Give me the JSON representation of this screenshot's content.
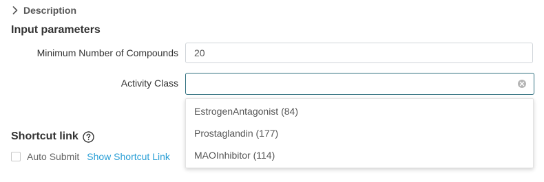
{
  "description": {
    "label": "Description",
    "expanded": false
  },
  "input_parameters": {
    "title": "Input parameters",
    "min_compounds": {
      "label": "Minimum Number of Compounds",
      "value": "20"
    },
    "activity_class": {
      "label": "Activity Class",
      "value": "",
      "options": [
        "EstrogenAntagonist (84)",
        "Prostaglandin (177)",
        "MAOInhibitor (114)"
      ]
    }
  },
  "shortcut": {
    "title": "Shortcut link",
    "auto_submit_label": "Auto Submit",
    "auto_submit_checked": false,
    "show_link_label": "Show Shortcut Link"
  },
  "colors": {
    "focus_border": "#2f6f7e",
    "link": "#2a9fd6"
  }
}
